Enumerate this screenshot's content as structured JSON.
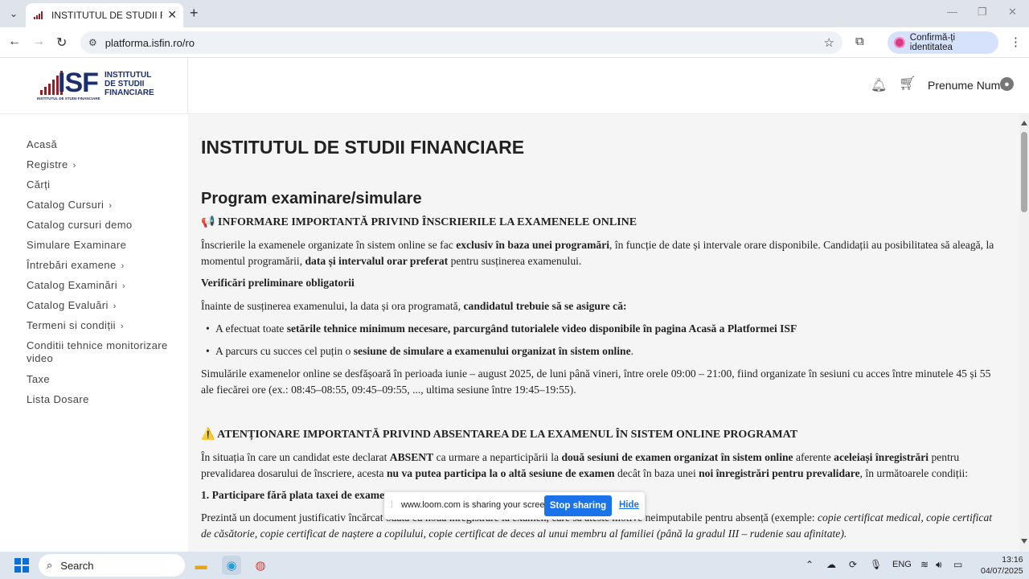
{
  "browser": {
    "tab_title": "INSTITUTUL DE STUDII FINANC",
    "tab_close": "✕",
    "new_tab": "+",
    "url": "platforma.isfin.ro/ro",
    "profile_label": "Confirmă-ți identitatea",
    "window_controls": [
      "—",
      "❐",
      "✕"
    ]
  },
  "header": {
    "logo_mark": "ISF",
    "logo_name": "INSTITUTUL DE STUDII FINANCIARE",
    "logo_sub": "INSTITUTUL DE STUDII FINANCIARE",
    "user_name": "Prenume Nume"
  },
  "sidebar": {
    "items": [
      {
        "label": "Acasă",
        "has_children": false
      },
      {
        "label": "Registre",
        "has_children": true
      },
      {
        "label": "Cărți",
        "has_children": false
      },
      {
        "label": "Catalog Cursuri",
        "has_children": true
      },
      {
        "label": "Catalog cursuri demo",
        "has_children": false
      },
      {
        "label": "Simulare Examinare",
        "has_children": false
      },
      {
        "label": "Întrebări examene",
        "has_children": true
      },
      {
        "label": "Catalog Examinări",
        "has_children": true
      },
      {
        "label": "Catalog Evaluări",
        "has_children": true
      },
      {
        "label": "Termeni si condiții",
        "has_children": true
      },
      {
        "label": "Conditii tehnice monitorizare video",
        "has_children": false
      },
      {
        "label": "Taxe",
        "has_children": false
      },
      {
        "label": "Lista Dosare",
        "has_children": false
      }
    ]
  },
  "content": {
    "title": "INSTITUTUL DE STUDII FINANCIARE",
    "subtitle": "Program examinare/simulare",
    "notice1_heading": "📢 INFORMARE IMPORTANTĂ PRIVIND ÎNSCRIERILE LA EXAMENELE ONLINE",
    "p1": {
      "a": "Înscrierile la examenele organizate în sistem online se fac ",
      "b": "exclusiv în baza unei programări",
      "c": ", în funcție de date și intervale orare disponibile. Candidații au posibilitatea să aleagă, la momentul programării, ",
      "d": "data și intervalul orar preferat",
      "e": " pentru susținerea examenului."
    },
    "verif_heading": "Verificări preliminare obligatorii",
    "p2": {
      "a": "Înainte de susținerea examenului, la data și ora programată, ",
      "b": "candidatul trebuie să se asigure că:"
    },
    "bullet1": {
      "a": "A efectuat toate ",
      "b": "setările tehnice minimum necesare, parcurgând tutorialele video disponibile în pagina Acasă a Platformei ISF"
    },
    "bullet2": {
      "a": "A parcurs cu succes cel puțin o ",
      "b": "sesiune de simulare a examenului organizat în sistem online",
      "c": "."
    },
    "p3": "Simulările examenelor online se desfășoară în perioada iunie – august 2025, de luni până vineri, între orele 09:00 – 21:00, fiind organizate în sesiuni cu acces între minutele 45 și 55 ale fiecărei ore (ex.: 08:45–08:55, 09:45–09:55, ..., ultima sesiune între 19:45–19:55).",
    "notice2_heading": "⚠️ ATENȚIONARE IMPORTANTĂ PRIVIND ABSENTAREA DE LA EXAMENUL ÎN SISTEM ONLINE PROGRAMAT",
    "p4": {
      "a": "În situația în care un candidat este declarat ",
      "b": "ABSENT",
      "c": " ca urmare a neparticipării la ",
      "d": "două sesiuni de examen organizat în sistem online",
      "e": " aferente ",
      "f": "aceleiași înregistrări",
      "g": " pentru prevalidarea dosarului de înscriere, acesta ",
      "h": "nu va putea participa la o altă sesiune de examen",
      "i": " decât în baza unei ",
      "j": "noi înregistrări pentru prevalidare",
      "k": ", în următoarele condiții:"
    },
    "section1_heading": "1. Participare fără plata taxei de examen",
    "p5": {
      "a": "Prezintă un document justificativ încărcat odată cu noua înregistrare la examen, care să atestе motive neimputabile pentru absență (exemple: ",
      "b": "copie certificat medical, copie certificat de căsătorie, copie certificat de naștere a copilului, copie certificat de deces al unui membru al familiei (până la gradul III – rudenie sau afinitate)."
    }
  },
  "loom": {
    "message": "www.loom.com is sharing your screen.",
    "stop_label": "Stop sharing",
    "hide_label": "Hide"
  },
  "taskbar": {
    "search_label": "Search",
    "language": "ENG",
    "time": "13:16",
    "date": "04/07/2025"
  }
}
